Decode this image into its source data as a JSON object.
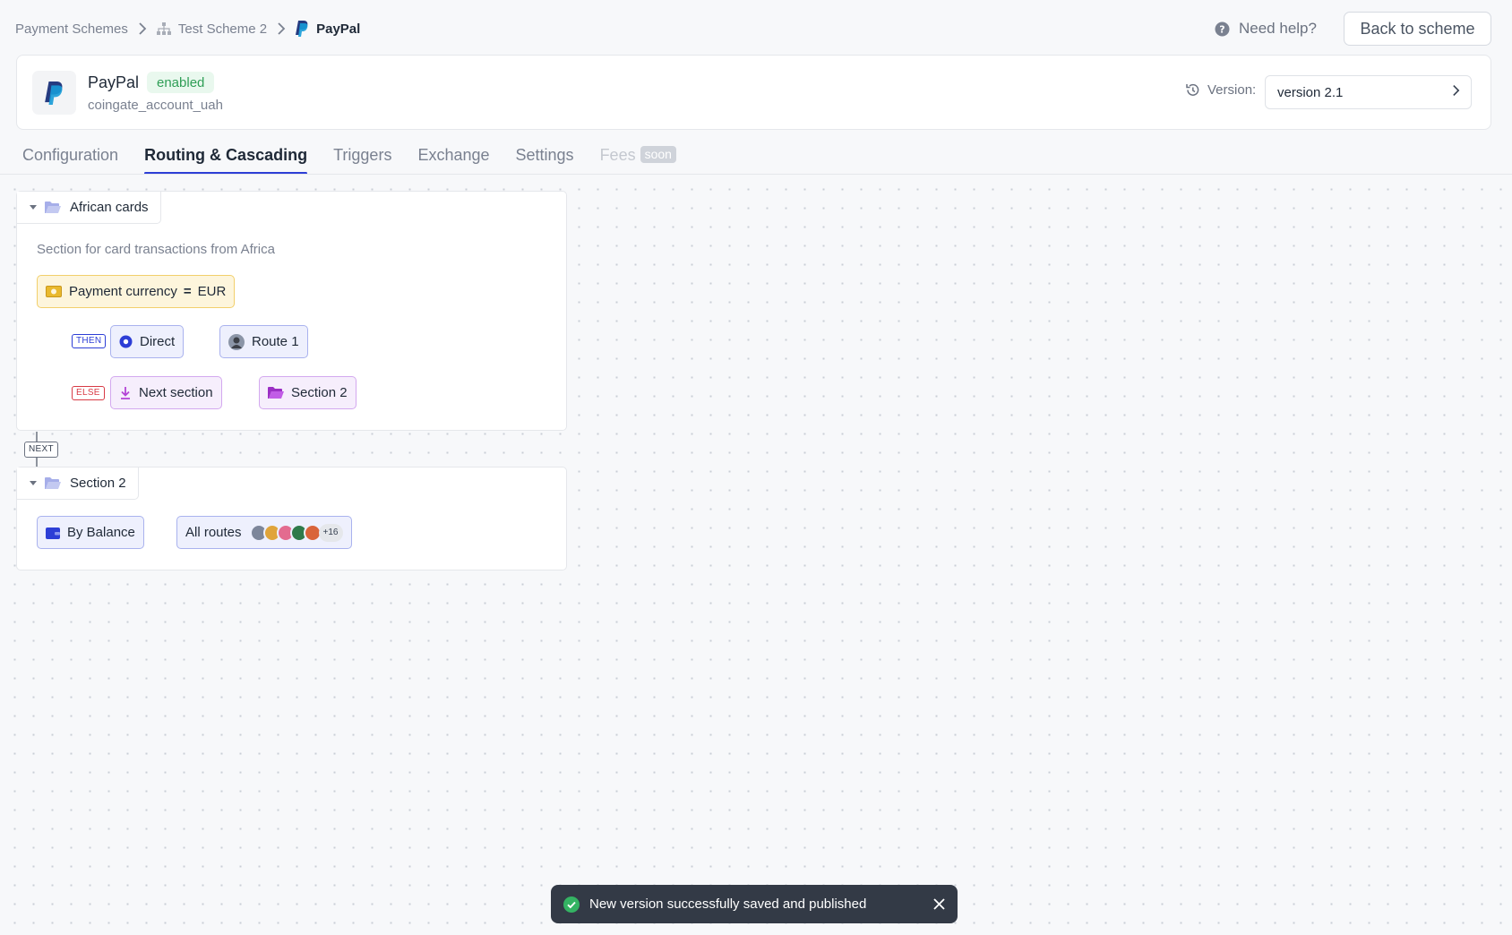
{
  "breadcrumb": {
    "items": [
      "Payment Schemes",
      "Test Scheme 2",
      "PayPal"
    ],
    "icons": [
      "hierarchy-icon",
      "paypal-icon"
    ]
  },
  "help": {
    "label": "Need help?"
  },
  "back_button": {
    "label": "Back to scheme"
  },
  "provider": {
    "name": "PayPal",
    "status": "enabled",
    "account": "coingate_account_uah",
    "version_label": "Version:",
    "version_value": "version 2.1"
  },
  "tabs": [
    {
      "label": "Configuration",
      "active": false
    },
    {
      "label": "Routing & Cascading",
      "active": true
    },
    {
      "label": "Triggers",
      "active": false
    },
    {
      "label": "Exchange",
      "active": false
    },
    {
      "label": "Settings",
      "active": false
    },
    {
      "label": "Fees",
      "active": false,
      "badge": "soon",
      "disabled": true
    }
  ],
  "sections": [
    {
      "title": "African cards",
      "description": "Section for card transactions from Africa",
      "condition": {
        "field": "Payment currency",
        "operator": "=",
        "value": "EUR"
      },
      "then": {
        "tag": "THEN",
        "action": "Direct",
        "target": "Route 1"
      },
      "else": {
        "tag": "ELSE",
        "action": "Next section",
        "target": "Section 2"
      }
    },
    {
      "title": "Section 2",
      "rule": {
        "action": "By Balance",
        "target": "All routes",
        "more_count": "+16"
      }
    }
  ],
  "connector": {
    "tag": "NEXT"
  },
  "toast": {
    "message": "New version successfully saved and published"
  },
  "colors": {
    "accent": "#2d3ed6",
    "else": "#d83a45",
    "next_section": "#b443d6",
    "success": "#2f9e56",
    "condition_border": "#f2cf6b"
  }
}
